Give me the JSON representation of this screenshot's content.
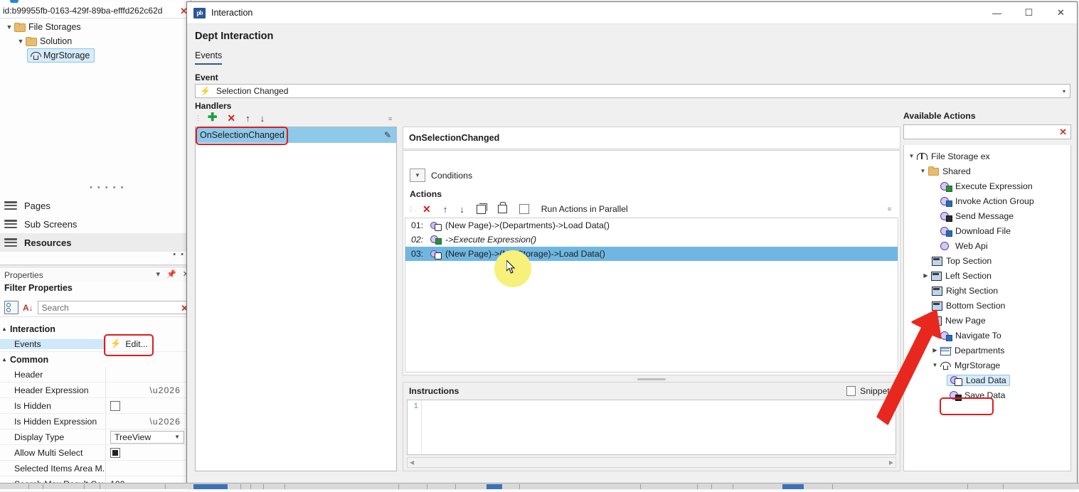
{
  "ide": {
    "id_bar": {
      "text": "id:b99955fb-0163-429f-89ba-efffd262c62d",
      "close_icon": "✕"
    },
    "tree": [
      {
        "label": "File Storages",
        "twisty": "▼",
        "level": 0
      },
      {
        "label": "Solution",
        "twisty": "▼",
        "level": 1
      },
      {
        "label": "MgrStorage",
        "twisty": "",
        "level": 2,
        "selected": true
      }
    ],
    "nav": [
      {
        "label": "Pages",
        "current": false
      },
      {
        "label": "Sub Screens",
        "current": false
      },
      {
        "label": "Resources",
        "current": true
      }
    ],
    "dots_more": "• •",
    "dots_center": "• • • • •",
    "properties": {
      "panel_title": "Properties",
      "panel_controls": [
        "▾",
        "⚓",
        "✕"
      ],
      "filter_title": "Filter Properties",
      "search_placeholder": "Search",
      "search_clear": "✕",
      "sort_az": "A↓",
      "groups": [
        {
          "name": "Interaction",
          "twisty": "▴",
          "rows": [
            {
              "name": "Events",
              "value": "Edit...",
              "type": "button",
              "selected": true,
              "highlighted": true
            }
          ]
        },
        {
          "name": "Common",
          "twisty": "▴",
          "rows": [
            {
              "name": "Header",
              "value": "",
              "type": "text"
            },
            {
              "name": "Header Expression",
              "value": "",
              "type": "ellipsis"
            },
            {
              "name": "Is Hidden",
              "value": "",
              "type": "checkbox",
              "checked": false
            },
            {
              "name": "Is Hidden Expression",
              "value": "",
              "type": "ellipsis"
            },
            {
              "name": "Display Type",
              "value": "TreeView",
              "type": "combo"
            },
            {
              "name": "Allow Multi Select",
              "value": "",
              "type": "checkbox-filled",
              "checked": true
            },
            {
              "name": "Selected Items Area M...",
              "value": "",
              "type": "text"
            },
            {
              "name": "Search Max Result Cou...",
              "value": "100",
              "type": "text"
            }
          ]
        }
      ]
    }
  },
  "dialog": {
    "title": "Interaction",
    "app_icon_text": "pb",
    "window_buttons": {
      "minimize": "—",
      "maximize": "☐",
      "close": "✕"
    },
    "heading": "Dept Interaction",
    "tabs": [
      {
        "label": "Events",
        "active": true
      }
    ],
    "event": {
      "label": "Event",
      "selected": "Selection Changed",
      "bolt_icon": "⚡",
      "caret": "▾"
    },
    "handlers": {
      "label": "Handlers",
      "toolbar": [
        {
          "name": "add",
          "glyph": "✚"
        },
        {
          "name": "delete",
          "glyph": "✕"
        },
        {
          "name": "move-up",
          "glyph": "↑"
        },
        {
          "name": "move-down",
          "glyph": "↓"
        }
      ],
      "items": [
        {
          "label": "OnSelectionChanged",
          "selected": true,
          "highlighted": true,
          "edit_icon": "✎"
        }
      ]
    },
    "detail": {
      "header": "OnSelectionChanged",
      "conditions_label": "Conditions",
      "conditions_caret": "▼",
      "actions_label": "Actions",
      "actions_toolbar": [
        {
          "name": "delete-action",
          "glyph": "✕"
        },
        {
          "name": "move-action-up",
          "glyph": "↑"
        },
        {
          "name": "move-action-down",
          "glyph": "↓"
        },
        {
          "name": "copy-action",
          "glyph": ""
        },
        {
          "name": "paste-action",
          "glyph": ""
        }
      ],
      "run_parallel_label": "Run Actions in Parallel",
      "run_parallel_checked": false,
      "actions": [
        {
          "num": "01:",
          "text": "(New Page)->(Departments)->Load Data()",
          "icon": "page-source-icon",
          "italic": false,
          "selected": false
        },
        {
          "num": "02:",
          "text": "->Execute Expression()",
          "icon": "expression-icon",
          "italic": true,
          "selected": false
        },
        {
          "num": "03:",
          "text": "(New Page)->(MgrStorage)->Load Data()",
          "icon": "page-source-icon",
          "italic": false,
          "selected": true
        }
      ]
    },
    "instructions": {
      "label": "Instructions",
      "snippets_label": "Snippets",
      "snippets_checked": false,
      "line_numbers": [
        "1"
      ],
      "code": ""
    },
    "available_actions": {
      "title": "Available Actions",
      "search_value": "",
      "search_clear": "✕",
      "tree": [
        {
          "label": "File Storage ex",
          "indent": 0,
          "twisty": "▼",
          "icon": "book-icon"
        },
        {
          "label": "Shared",
          "indent": 1,
          "twisty": "▼",
          "icon": "folder-icon"
        },
        {
          "label": "Execute Expression",
          "indent": 2,
          "twisty": "",
          "icon": "expression-action-icon"
        },
        {
          "label": "Invoke Action Group",
          "indent": 2,
          "twisty": "",
          "icon": "invoke-action-icon"
        },
        {
          "label": "Send Message",
          "indent": 2,
          "twisty": "",
          "icon": "send-message-icon"
        },
        {
          "label": "Download File",
          "indent": 2,
          "twisty": "",
          "icon": "download-file-icon"
        },
        {
          "label": "Web Api",
          "indent": 2,
          "twisty": "",
          "icon": "web-api-icon"
        },
        {
          "label": "Top Section",
          "indent": 1,
          "twisty": "",
          "icon": "section-icon"
        },
        {
          "label": "Left Section",
          "indent": 1,
          "twisty": "▶",
          "icon": "section-icon"
        },
        {
          "label": "Right Section",
          "indent": 1,
          "twisty": "",
          "icon": "section-icon"
        },
        {
          "label": "Bottom Section",
          "indent": 1,
          "twisty": "",
          "icon": "section-icon"
        },
        {
          "label": "New Page",
          "indent": 1,
          "twisty": "▼",
          "icon": "page-icon"
        },
        {
          "label": "Navigate To",
          "indent": 2,
          "twisty": "",
          "icon": "navigate-to-icon"
        },
        {
          "label": "Departments",
          "indent": 2,
          "twisty": "▶",
          "icon": "grid-icon"
        },
        {
          "label": "MgrStorage",
          "indent": 2,
          "twisty": "▼",
          "icon": "mushroom-icon"
        },
        {
          "label": "Load Data",
          "indent": 3,
          "twisty": "",
          "icon": "page-source-icon",
          "selected": true
        },
        {
          "label": "Save Data",
          "indent": 3,
          "twisty": "",
          "icon": "save-data-icon"
        }
      ]
    }
  },
  "annotations": {
    "accent_red": "#e01b1b",
    "selection_blue": "#6fb7e2",
    "highlight_yellow": "#f7f07a"
  }
}
